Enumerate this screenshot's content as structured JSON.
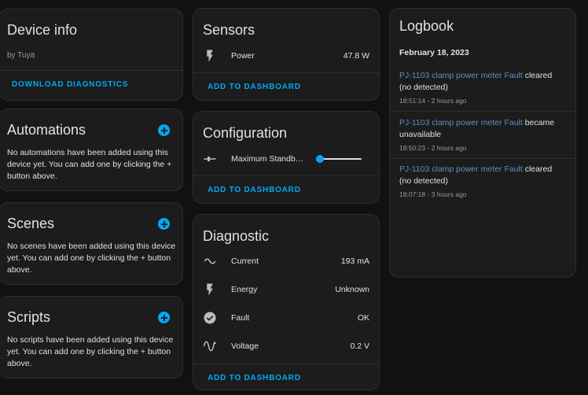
{
  "device_info": {
    "title": "Device info",
    "manufacturer": "by Tuya",
    "action": "DOWNLOAD DIAGNOSTICS"
  },
  "automations": {
    "title": "Automations",
    "text": "No automations have been added using this device yet. You can add one by clicking the + button above."
  },
  "scenes": {
    "title": "Scenes",
    "text": "No scenes have been added using this device yet. You can add one by clicking the + button above."
  },
  "scripts": {
    "title": "Scripts",
    "text": "No scripts have been added using this device yet. You can add one by clicking the + button above."
  },
  "sensors": {
    "title": "Sensors",
    "rows": [
      {
        "label": "Power",
        "value": "47.8 W",
        "icon": "flash-icon"
      }
    ],
    "action": "ADD TO DASHBOARD"
  },
  "configuration": {
    "title": "Configuration",
    "rows": [
      {
        "label": "Maximum Standb…",
        "icon": "slider-icon",
        "slider_fraction": 0.0
      }
    ],
    "action": "ADD TO DASHBOARD"
  },
  "diagnostic": {
    "title": "Diagnostic",
    "rows": [
      {
        "label": "Current",
        "value": "193 mA",
        "icon": "current-ac-icon"
      },
      {
        "label": "Energy",
        "value": "Unknown",
        "icon": "flash-icon"
      },
      {
        "label": "Fault",
        "value": "OK",
        "icon": "check-circle-icon"
      },
      {
        "label": "Voltage",
        "value": "0.2 V",
        "icon": "sine-wave-icon"
      }
    ],
    "action": "ADD TO DASHBOARD"
  },
  "logbook": {
    "title": "Logbook",
    "date": "February 18, 2023",
    "entries": [
      {
        "entity": "PJ-1103 clamp power meter Fault",
        "message": "cleared (no detected)",
        "time": "18:51:14 - 2 hours ago"
      },
      {
        "entity": "PJ-1103 clamp power meter Fault",
        "message": "became unavailable",
        "time": "18:50:23 - 2 hours ago"
      },
      {
        "entity": "PJ-1103 clamp power meter Fault",
        "message": "cleared (no detected)",
        "time": "18:07:18 - 3 hours ago"
      }
    ]
  },
  "colors": {
    "accent": "#03a9f4",
    "card_bg": "#1c1c1c",
    "page_bg": "#111111",
    "link": "#5c8fc2"
  }
}
